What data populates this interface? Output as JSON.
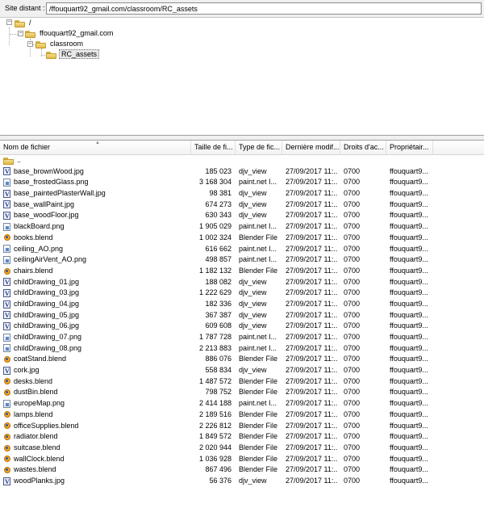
{
  "path_bar": {
    "label": "Site distant :",
    "value": "/ffouquart92_gmail.com/classroom/RC_assets"
  },
  "tree": {
    "nodes": [
      {
        "label": "/"
      },
      {
        "label": "ffouquart92_gmail.com"
      },
      {
        "label": "classroom"
      },
      {
        "label": "RC_assets"
      }
    ]
  },
  "file_list": {
    "columns": [
      "Nom de fichier",
      "Taille de fi...",
      "Type de fic...",
      "Dernière modif...",
      "Droits d'ac...",
      "Propriétair..."
    ],
    "parent_entry": "..",
    "rows": [
      {
        "name": "base_brownWood.jpg",
        "size": "185 023",
        "type": "djv_view",
        "date": "27/09/2017 11:...",
        "perms": "0700",
        "owner": "ffouquart9...",
        "icon": "djv-icon"
      },
      {
        "name": "base_frostedGlass.png",
        "size": "3 168 304",
        "type": "paint.net I...",
        "date": "27/09/2017 11:...",
        "perms": "0700",
        "owner": "ffouquart9...",
        "icon": "paint-icon"
      },
      {
        "name": "base_paintedPlasterWall.jpg",
        "size": "98 381",
        "type": "djv_view",
        "date": "27/09/2017 11:...",
        "perms": "0700",
        "owner": "ffouquart9...",
        "icon": "djv-icon"
      },
      {
        "name": "base_wallPaint.jpg",
        "size": "674 273",
        "type": "djv_view",
        "date": "27/09/2017 11:...",
        "perms": "0700",
        "owner": "ffouquart9...",
        "icon": "djv-icon"
      },
      {
        "name": "base_woodFloor.jpg",
        "size": "630 343",
        "type": "djv_view",
        "date": "27/09/2017 11:...",
        "perms": "0700",
        "owner": "ffouquart9...",
        "icon": "djv-icon"
      },
      {
        "name": "blackBoard.png",
        "size": "1 905 029",
        "type": "paint.net I...",
        "date": "27/09/2017 11:...",
        "perms": "0700",
        "owner": "ffouquart9...",
        "icon": "paint-icon"
      },
      {
        "name": "books.blend",
        "size": "1 002 324",
        "type": "Blender File",
        "date": "27/09/2017 11:...",
        "perms": "0700",
        "owner": "ffouquart9...",
        "icon": "blend-icon"
      },
      {
        "name": "ceiling_AO.png",
        "size": "616 662",
        "type": "paint.net I...",
        "date": "27/09/2017 11:...",
        "perms": "0700",
        "owner": "ffouquart9...",
        "icon": "paint-icon"
      },
      {
        "name": "ceilingAirVent_AO.png",
        "size": "498 857",
        "type": "paint.net I...",
        "date": "27/09/2017 11:...",
        "perms": "0700",
        "owner": "ffouquart9...",
        "icon": "paint-icon"
      },
      {
        "name": "chairs.blend",
        "size": "1 182 132",
        "type": "Blender File",
        "date": "27/09/2017 11:...",
        "perms": "0700",
        "owner": "ffouquart9...",
        "icon": "blend-icon"
      },
      {
        "name": "childDrawing_01.jpg",
        "size": "188 082",
        "type": "djv_view",
        "date": "27/09/2017 11:...",
        "perms": "0700",
        "owner": "ffouquart9...",
        "icon": "djv-icon"
      },
      {
        "name": "childDrawing_03.jpg",
        "size": "1 222 629",
        "type": "djv_view",
        "date": "27/09/2017 11:...",
        "perms": "0700",
        "owner": "ffouquart9...",
        "icon": "djv-icon"
      },
      {
        "name": "childDrawing_04.jpg",
        "size": "182 336",
        "type": "djv_view",
        "date": "27/09/2017 11:...",
        "perms": "0700",
        "owner": "ffouquart9...",
        "icon": "djv-icon"
      },
      {
        "name": "childDrawing_05.jpg",
        "size": "367 387",
        "type": "djv_view",
        "date": "27/09/2017 11:...",
        "perms": "0700",
        "owner": "ffouquart9...",
        "icon": "djv-icon"
      },
      {
        "name": "childDrawing_06.jpg",
        "size": "609 608",
        "type": "djv_view",
        "date": "27/09/2017 11:...",
        "perms": "0700",
        "owner": "ffouquart9...",
        "icon": "djv-icon"
      },
      {
        "name": "childDrawing_07.png",
        "size": "1 787 728",
        "type": "paint.net I...",
        "date": "27/09/2017 11:...",
        "perms": "0700",
        "owner": "ffouquart9...",
        "icon": "paint-icon"
      },
      {
        "name": "childDrawing_08.png",
        "size": "2 213 883",
        "type": "paint.net I...",
        "date": "27/09/2017 11:...",
        "perms": "0700",
        "owner": "ffouquart9...",
        "icon": "paint-icon"
      },
      {
        "name": "coatStand.blend",
        "size": "886 076",
        "type": "Blender File",
        "date": "27/09/2017 11:...",
        "perms": "0700",
        "owner": "ffouquart9...",
        "icon": "blend-icon"
      },
      {
        "name": "cork.jpg",
        "size": "558 834",
        "type": "djv_view",
        "date": "27/09/2017 11:...",
        "perms": "0700",
        "owner": "ffouquart9...",
        "icon": "djv-icon"
      },
      {
        "name": "desks.blend",
        "size": "1 487 572",
        "type": "Blender File",
        "date": "27/09/2017 11:...",
        "perms": "0700",
        "owner": "ffouquart9...",
        "icon": "blend-icon"
      },
      {
        "name": "dustBin.blend",
        "size": "798 752",
        "type": "Blender File",
        "date": "27/09/2017 11:...",
        "perms": "0700",
        "owner": "ffouquart9...",
        "icon": "blend-icon"
      },
      {
        "name": "europeMap.png",
        "size": "2 414 188",
        "type": "paint.net I...",
        "date": "27/09/2017 11:...",
        "perms": "0700",
        "owner": "ffouquart9...",
        "icon": "paint-icon"
      },
      {
        "name": "lamps.blend",
        "size": "2 189 516",
        "type": "Blender File",
        "date": "27/09/2017 11:...",
        "perms": "0700",
        "owner": "ffouquart9...",
        "icon": "blend-icon"
      },
      {
        "name": "officeSupplies.blend",
        "size": "2 226 812",
        "type": "Blender File",
        "date": "27/09/2017 11:...",
        "perms": "0700",
        "owner": "ffouquart9...",
        "icon": "blend-icon"
      },
      {
        "name": "radiator.blend",
        "size": "1 849 572",
        "type": "Blender File",
        "date": "27/09/2017 11:...",
        "perms": "0700",
        "owner": "ffouquart9...",
        "icon": "blend-icon"
      },
      {
        "name": "suitcase.blend",
        "size": "2 020 944",
        "type": "Blender File",
        "date": "27/09/2017 11:...",
        "perms": "0700",
        "owner": "ffouquart9...",
        "icon": "blend-icon"
      },
      {
        "name": "wallClock.blend",
        "size": "1 036 928",
        "type": "Blender File",
        "date": "27/09/2017 11:...",
        "perms": "0700",
        "owner": "ffouquart9...",
        "icon": "blend-icon"
      },
      {
        "name": "wastes.blend",
        "size": "867 496",
        "type": "Blender File",
        "date": "27/09/2017 11:...",
        "perms": "0700",
        "owner": "ffouquart9...",
        "icon": "blend-icon"
      },
      {
        "name": "woodPlanks.jpg",
        "size": "56 376",
        "type": "djv_view",
        "date": "27/09/2017 11:...",
        "perms": "0700",
        "owner": "ffouquart9...",
        "icon": "djv-icon"
      }
    ]
  }
}
